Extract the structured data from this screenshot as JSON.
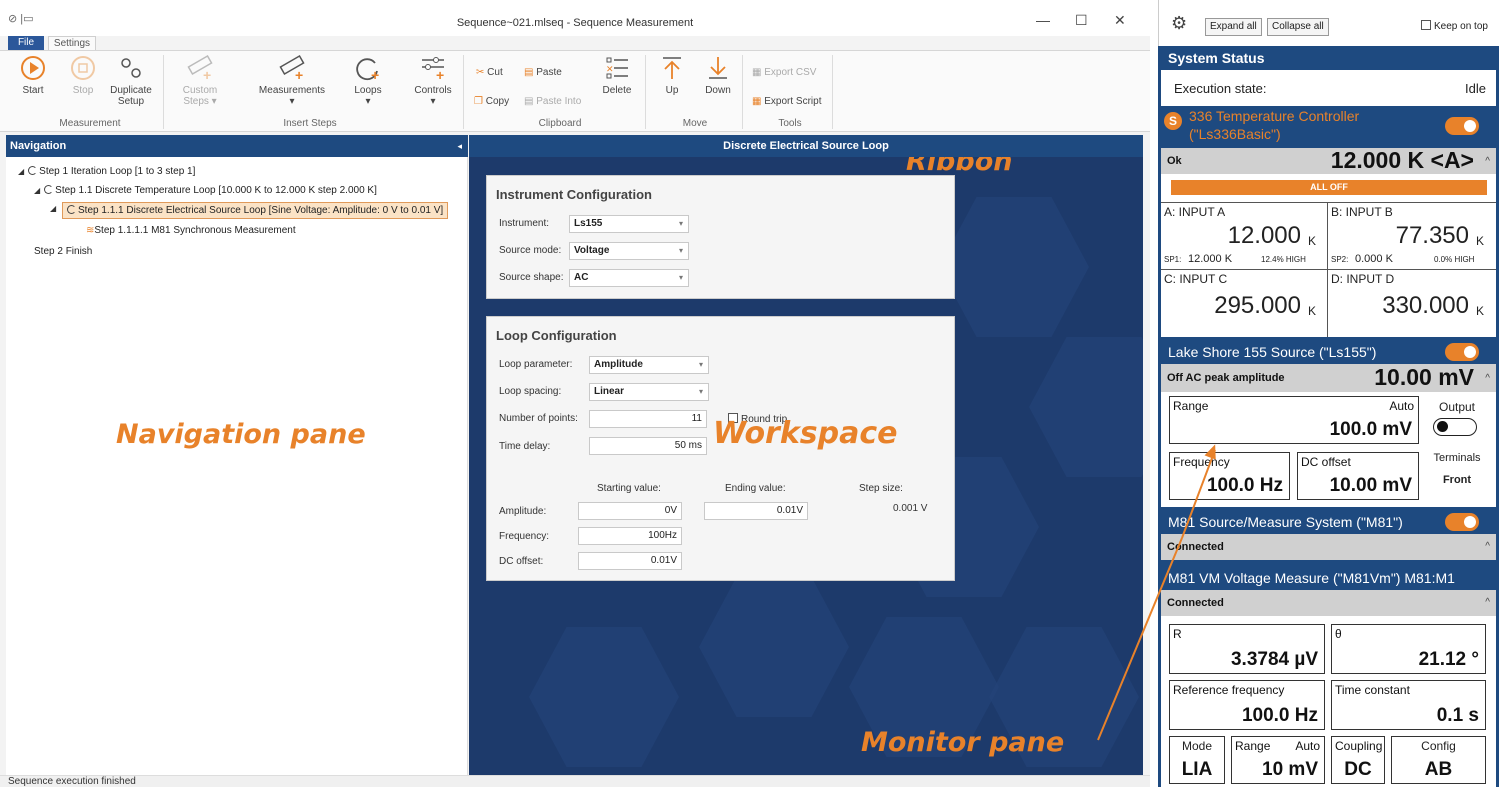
{
  "window": {
    "title": "Sequence~021.mlseq - Sequence Measurement",
    "minimize": "—",
    "maximize": "☐",
    "close": "✕"
  },
  "tabs": {
    "file": "File",
    "settings": "Settings"
  },
  "ribbon": {
    "start": "Start",
    "stop": "Stop",
    "duplicate_setup_1": "Duplicate",
    "duplicate_setup_2": "Setup",
    "custom_steps_1": "Custom",
    "custom_steps_2": "Steps ▾",
    "measurements": "Measurements",
    "loops": "Loops",
    "controls": "Controls",
    "cut": "Cut",
    "copy": "Copy",
    "paste": "Paste",
    "paste_into": "Paste Into",
    "delete": "Delete",
    "up": "Up",
    "down": "Down",
    "export_csv": "Export CSV",
    "export_script": "Export Script",
    "groups": {
      "measurement": "Measurement",
      "insert_steps": "Insert Steps",
      "clipboard": "Clipboard",
      "move": "Move",
      "tools": "Tools"
    }
  },
  "navigation": {
    "header": "Navigation",
    "collapse": "◂",
    "tree": [
      "Step 1 Iteration Loop [1 to 3 step 1]",
      "Step 1.1 Discrete Temperature Loop [10.000 K to 12.000 K step 2.000 K]",
      "Step 1.1.1 Discrete Electrical Source Loop [Sine Voltage: Amplitude: 0 V to 0.01 V]",
      "Step 1.1.1.1 M81 Synchronous Measurement",
      "Step 2 Finish"
    ]
  },
  "overlays": {
    "ribbon": "Ribbon",
    "navigation": "Navigation pane",
    "workspace": "Workspace",
    "monitor": "Monitor pane"
  },
  "workspace": {
    "header": "Discrete Electrical Source Loop",
    "instrument_config": {
      "title": "Instrument Configuration",
      "instrument_label": "Instrument:",
      "instrument_value": "Ls155",
      "source_mode_label": "Source mode:",
      "source_mode_value": "Voltage",
      "source_shape_label": "Source shape:",
      "source_shape_value": "AC"
    },
    "loop_config": {
      "title": "Loop Configuration",
      "loop_parameter_label": "Loop parameter:",
      "loop_parameter_value": "Amplitude",
      "loop_spacing_label": "Loop spacing:",
      "loop_spacing_value": "Linear",
      "num_points_label": "Number of points:",
      "num_points_value": "11",
      "round_trip_label": "Round trip",
      "time_delay_label": "Time delay:",
      "time_delay_value": "50 ms",
      "starting_value_header": "Starting value:",
      "ending_value_header": "Ending value:",
      "step_size_header": "Step size:",
      "amplitude_label": "Amplitude:",
      "amplitude_start": "0V",
      "amplitude_end": "0.01V",
      "amplitude_step": "0.001 V",
      "frequency_label": "Frequency:",
      "frequency_value": "100Hz",
      "dc_offset_label": "DC offset:",
      "dc_offset_value": "0.01V"
    }
  },
  "status_bar": "Sequence execution finished",
  "monitor": {
    "expand_all": "Expand all",
    "collapse_all": "Collapse all",
    "keep_on_top": "Keep on top",
    "system_status": "System Status",
    "execution_state_label": "Execution state:",
    "execution_state_value": "Idle",
    "ls336": {
      "title_1": "336 Temperature Controller",
      "title_2": "(\"Ls336Basic\")",
      "status": "Ok",
      "reading": "12.000 K <A>",
      "all_off": "ALL OFF",
      "input_a_label": "A: INPUT A",
      "input_a_value": "12.000",
      "input_a_unit": "K",
      "sp1": "SP1:",
      "sp1_value": "12.000 K",
      "sp1_heater": "12.4% HIGH",
      "input_b_label": "B: INPUT B",
      "input_b_value": "77.350",
      "input_b_unit": "K",
      "sp2": "SP2:",
      "sp2_value": "0.000 K",
      "sp2_heater": "0.0% HIGH",
      "input_c_label": "C: INPUT C",
      "input_c_value": "295.000",
      "input_c_unit": "K",
      "input_d_label": "D: INPUT D",
      "input_d_value": "330.000",
      "input_d_unit": "K"
    },
    "ls155": {
      "title": "Lake Shore 155 Source (\"Ls155\")",
      "status": "Off AC peak amplitude",
      "reading": "10.00 mV",
      "range_label": "Range",
      "range_auto": "Auto",
      "range_value": "100.0 mV",
      "output_label": "Output",
      "frequency_label": "Frequency",
      "frequency_value": "100.0 Hz",
      "dc_offset_label": "DC offset",
      "dc_offset_value": "10.00 mV",
      "terminals_label": "Terminals",
      "terminals_value": "Front"
    },
    "m81": {
      "title": "M81 Source/Measure System (\"M81\")",
      "status": "Connected"
    },
    "m81vm": {
      "title": "M81 VM Voltage Measure (\"M81Vm\") M81:M1",
      "status": "Connected",
      "r_label": "R",
      "r_value": "3.3784 µV",
      "theta_label": "θ",
      "theta_value": "21.12 °",
      "ref_freq_label": "Reference frequency",
      "ref_freq_value": "100.0 Hz",
      "time_const_label": "Time constant",
      "time_const_value": "0.1 s",
      "mode_label": "Mode",
      "mode_value": "LIA",
      "range_label": "Range",
      "range_auto": "Auto",
      "range_value": "10 mV",
      "coupling_label": "Coupling",
      "coupling_value": "DC",
      "config_label": "Config",
      "config_value": "AB"
    }
  },
  "colors": {
    "accent": "#e8822a",
    "header_blue": "#1e4a80",
    "workspace_bg": "#1d3a6b"
  }
}
